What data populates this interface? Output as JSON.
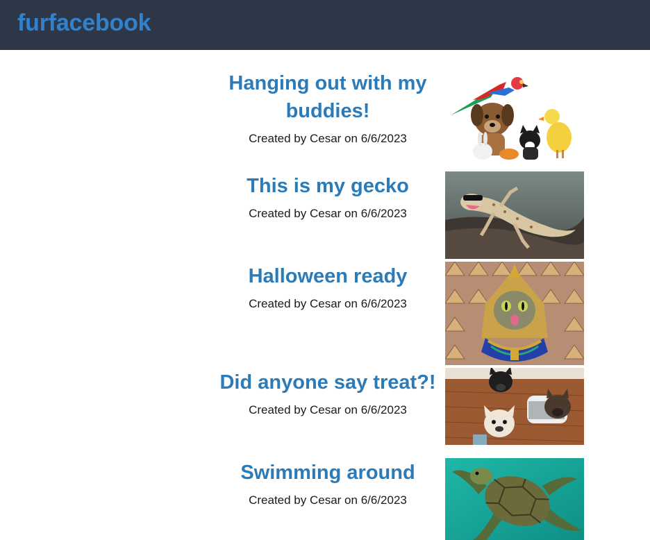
{
  "header": {
    "brand": "furfacebook"
  },
  "posts": [
    {
      "title": "Hanging out with my buddies!",
      "meta": "Created by Cesar on 6/6/2023",
      "image_subject": "parrot, puppy, kitten, duckling and bunny"
    },
    {
      "title": "This is my gecko",
      "meta": "Created by Cesar on 6/6/2023",
      "image_subject": "gecko on a log"
    },
    {
      "title": "Halloween ready",
      "meta": "Created by Cesar on 6/6/2023",
      "image_subject": "cat in pharaoh costume"
    },
    {
      "title": "Did anyone say treat?!",
      "meta": "Created by Cesar on 6/6/2023",
      "image_subject": "three french bulldogs looking up"
    },
    {
      "title": "Swimming around",
      "meta": "Created by Cesar on 6/6/2023",
      "image_subject": "sea turtle swimming"
    }
  ]
}
